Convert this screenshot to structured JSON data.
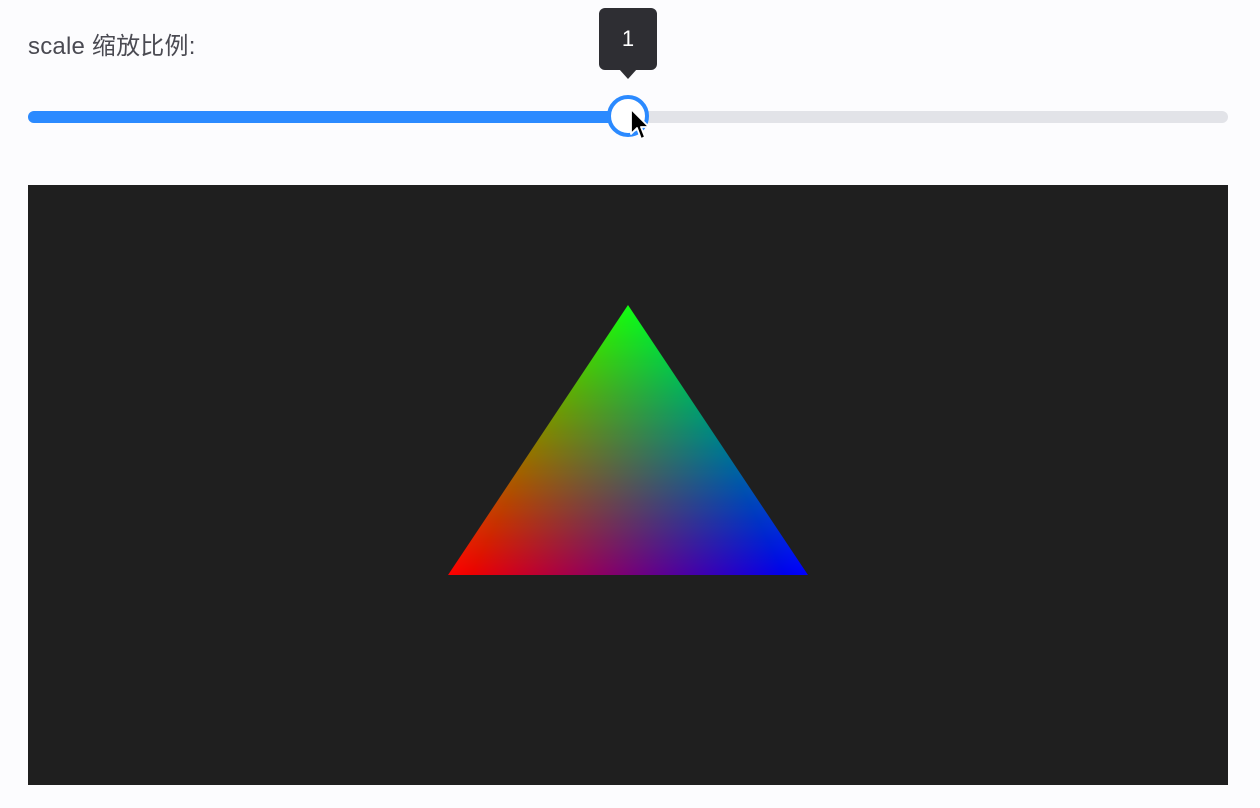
{
  "controls": {
    "scale_label": "scale 缩放比例:",
    "scale_value": 1,
    "scale_value_text": "1",
    "scale_fraction": 0.5
  },
  "colors": {
    "accent": "#2b8aff",
    "track": "#e2e3e8",
    "tooltip_bg": "#2e2e33",
    "canvas_bg": "#1f1f1f",
    "vertex_top": "#00ff00",
    "vertex_left": "#ff0000",
    "vertex_right": "#0000ff"
  },
  "icons": {
    "pointer": "mouse-pointer-icon"
  }
}
